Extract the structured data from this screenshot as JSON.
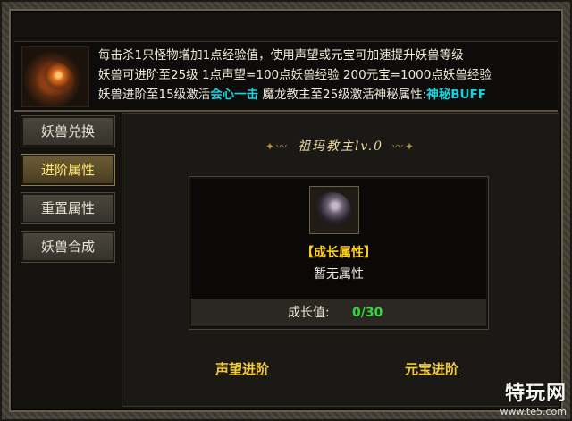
{
  "info": {
    "line1": "每击杀1只怪物增加1点经验值，使用声望或元宝可加速提升妖兽等级",
    "line2": "妖兽可进阶至25级  1点声望=100点妖兽经验  200元宝=1000点妖兽经验",
    "line3_prefix": "妖兽进阶至15级激活",
    "line3_highlight1": "会心一击",
    "line3_middle": "  魔龙教主至25级激活神秘属性:",
    "line3_highlight2": "神秘BUFF"
  },
  "menu": {
    "items": [
      {
        "label": "妖兽兑换",
        "active": false
      },
      {
        "label": "进阶属性",
        "active": true
      },
      {
        "label": "重置属性",
        "active": false
      },
      {
        "label": "妖兽合成",
        "active": false
      }
    ]
  },
  "main": {
    "pet_title": "祖玛教主lv.0",
    "attr_title": "【成长属性】",
    "attr_empty": "暂无属性",
    "growth_label": "成长值:",
    "growth_value": "0/30",
    "btn_prestige": "声望进阶",
    "btn_yuanbao": "元宝进阶"
  },
  "watermark": {
    "logo": "特玩网",
    "url": "www.te5.com"
  },
  "colors": {
    "highlight_cyan": "#18d2e0",
    "active_menu_text": "#ffe66a",
    "growth_green": "#35d83a",
    "button_gold": "#f1cc3a"
  }
}
